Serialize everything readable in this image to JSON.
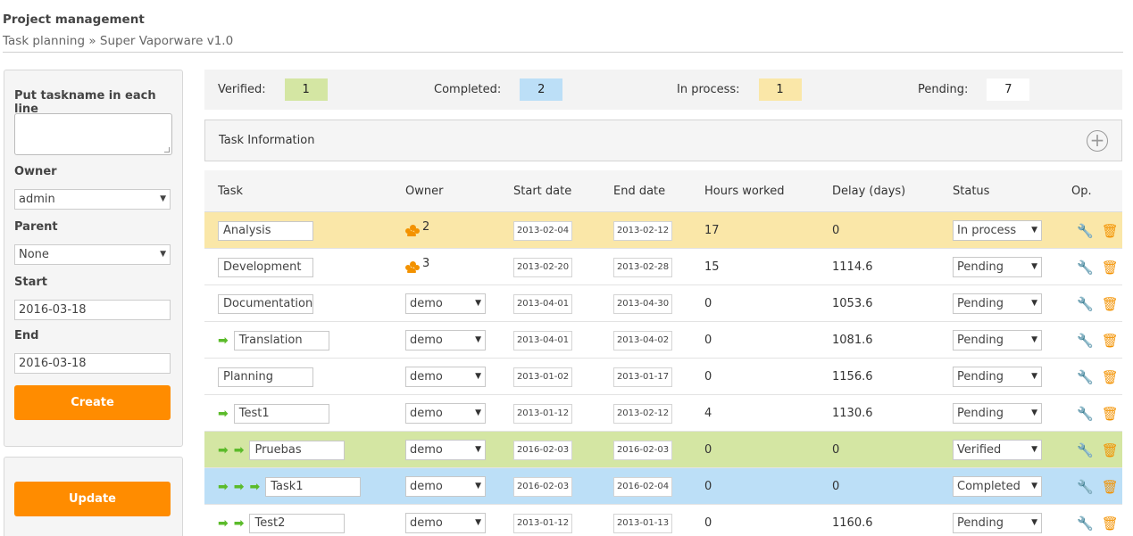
{
  "header": {
    "title": "Project management",
    "breadcrumb": "Task planning",
    "separator": "»",
    "project": "Super Vaporware v1.0"
  },
  "sidebar": {
    "taskname_label": "Put taskname in each line",
    "taskname_value": "",
    "owner_label": "Owner",
    "owner_value": "admin",
    "parent_label": "Parent",
    "parent_value": "None",
    "start_label": "Start",
    "start_value": "2016-03-18",
    "end_label": "End",
    "end_value": "2016-03-18",
    "create_button": "Create",
    "update_button": "Update"
  },
  "summary": {
    "verified_label": "Verified:",
    "verified_count": "1",
    "completed_label": "Completed:",
    "completed_count": "2",
    "inprocess_label": "In process:",
    "inprocess_count": "1",
    "pending_label": "Pending:",
    "pending_count": "7",
    "colors": {
      "verified": "#d4e6a3",
      "completed": "#bcdff7",
      "inprocess": "#fae7a8",
      "pending": "#ffffff"
    }
  },
  "task_info": {
    "title": "Task Information",
    "expand_icon": "plus-circle-icon"
  },
  "table": {
    "headers": [
      "Task",
      "Owner",
      "Start date",
      "End date",
      "Hours worked",
      "Delay (days)",
      "Status",
      "Op."
    ],
    "rows": [
      {
        "task": "Analysis",
        "indent": 0,
        "owner": "2",
        "owner_type": "group",
        "start": "2013-02-04",
        "end": "2013-02-12",
        "hours": "17",
        "delay": "0",
        "status": "In process",
        "state": "inprocess"
      },
      {
        "task": "Development",
        "indent": 0,
        "owner": "3",
        "owner_type": "group",
        "start": "2013-02-20",
        "end": "2013-02-28",
        "hours": "15",
        "delay": "1114.6",
        "status": "Pending",
        "state": "pending"
      },
      {
        "task": "Documentation",
        "indent": 0,
        "owner": "demo",
        "owner_type": "select",
        "start": "2013-04-01",
        "end": "2013-04-30",
        "hours": "0",
        "delay": "1053.6",
        "status": "Pending",
        "state": "pending"
      },
      {
        "task": "Translation",
        "indent": 1,
        "owner": "demo",
        "owner_type": "select",
        "start": "2013-04-01",
        "end": "2013-04-02",
        "hours": "0",
        "delay": "1081.6",
        "status": "Pending",
        "state": "pending"
      },
      {
        "task": "Planning",
        "indent": 0,
        "owner": "demo",
        "owner_type": "select",
        "start": "2013-01-02",
        "end": "2013-01-17",
        "hours": "0",
        "delay": "1156.6",
        "status": "Pending",
        "state": "pending"
      },
      {
        "task": "Test1",
        "indent": 1,
        "owner": "demo",
        "owner_type": "select",
        "start": "2013-01-12",
        "end": "2013-02-12",
        "hours": "4",
        "delay": "1130.6",
        "status": "Pending",
        "state": "pending"
      },
      {
        "task": "Pruebas",
        "indent": 2,
        "owner": "demo",
        "owner_type": "select",
        "start": "2016-02-03",
        "end": "2016-02-03",
        "hours": "0",
        "delay": "0",
        "status": "Verified",
        "state": "verified"
      },
      {
        "task": "Task1",
        "indent": 3,
        "owner": "demo",
        "owner_type": "select",
        "start": "2016-02-03",
        "end": "2016-02-04",
        "hours": "0",
        "delay": "0",
        "status": "Completed",
        "state": "completed"
      },
      {
        "task": "Test2",
        "indent": 2,
        "owner": "demo",
        "owner_type": "select",
        "start": "2013-01-12",
        "end": "2013-01-13",
        "hours": "0",
        "delay": "1160.6",
        "status": "Pending",
        "state": "pending"
      }
    ]
  },
  "icons": {
    "indent": "green-arrow-icon",
    "edit": "wrench-icon",
    "delete": "trash-icon",
    "group": "users-icon",
    "dropdown": "caret-down-icon"
  }
}
